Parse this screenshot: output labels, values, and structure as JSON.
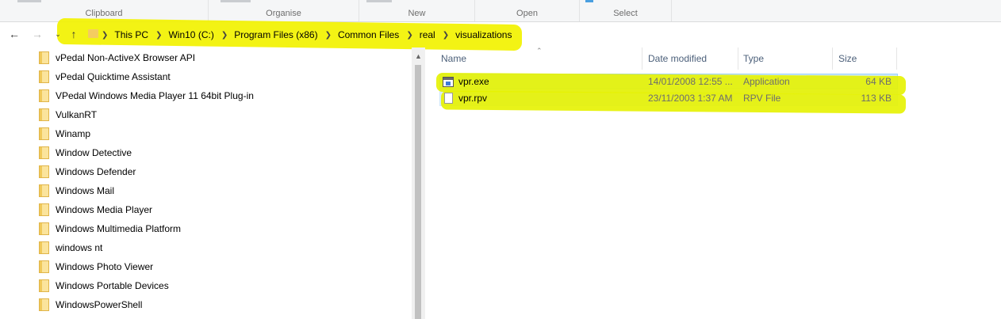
{
  "ribbon": {
    "groups": [
      "Clipboard",
      "Organise",
      "New",
      "Open",
      "Select"
    ]
  },
  "nav": {
    "back_icon": "arrow-left-icon",
    "forward_icon": "arrow-right-icon",
    "recent_icon": "chevron-down-icon",
    "up_icon": "arrow-up-icon"
  },
  "address": {
    "crumbs": [
      "This PC",
      "Win10 (C:)",
      "Program Files (x86)",
      "Common Files",
      "real",
      "visualizations"
    ]
  },
  "tree": {
    "items": [
      "vPedal Non-ActiveX Browser API",
      "vPedal Quicktime Assistant",
      "VPedal Windows Media Player 11 64bit Plug-in",
      "VulkanRT",
      "Winamp",
      "Window Detective",
      "Windows Defender",
      "Windows Mail",
      "Windows Media Player",
      "Windows Multimedia Platform",
      "windows nt",
      "Windows Photo Viewer",
      "Windows Portable Devices",
      "WindowsPowerShell"
    ]
  },
  "files": {
    "columns": {
      "name": "Name",
      "date": "Date modified",
      "type": "Type",
      "size": "Size"
    },
    "rows": [
      {
        "name": "vpr.exe",
        "date": "14/01/2008 12:55 ...",
        "type": "Application",
        "size": "64 KB",
        "icon": "application-icon"
      },
      {
        "name": "vpr.rpv",
        "date": "23/11/2003 1:37 AM",
        "type": "RPV File",
        "size": "113 KB",
        "icon": "file-icon"
      }
    ]
  },
  "colors": {
    "highlight": "#f2f200",
    "selection": "#cce8ff",
    "header_text": "#4c607a"
  }
}
